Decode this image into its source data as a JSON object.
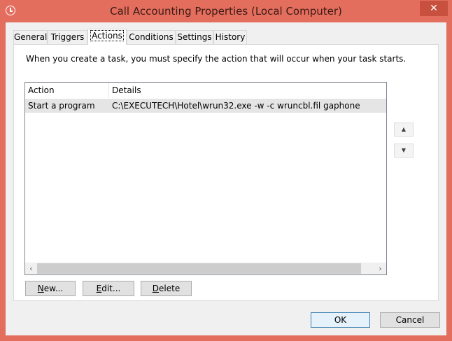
{
  "window": {
    "title": "Call Accounting Properties (Local Computer)",
    "close_glyph": "✕"
  },
  "tabs": [
    {
      "label": "General"
    },
    {
      "label": "Triggers"
    },
    {
      "label": "Actions",
      "active": true
    },
    {
      "label": "Conditions"
    },
    {
      "label": "Settings"
    },
    {
      "label": "History"
    }
  ],
  "actions_tab": {
    "intro": "When you create a task, you must specify the action that will occur when your task starts.",
    "columns": {
      "action": "Action",
      "details": "Details"
    },
    "rows": [
      {
        "action": "Start a program",
        "details": "C:\\EXECUTECH\\Hotel\\wrun32.exe -w -c wruncbl.fil gaphone"
      }
    ],
    "move_up_glyph": "▲",
    "move_down_glyph": "▼",
    "buttons": {
      "new": {
        "mnemonic": "N",
        "rest": "ew..."
      },
      "edit": {
        "mnemonic": "E",
        "rest": "dit..."
      },
      "delete": {
        "mnemonic": "D",
        "rest": "elete"
      }
    }
  },
  "footer": {
    "ok": "OK",
    "cancel": "Cancel"
  },
  "scrollbar": {
    "left_glyph": "‹",
    "right_glyph": "›"
  }
}
